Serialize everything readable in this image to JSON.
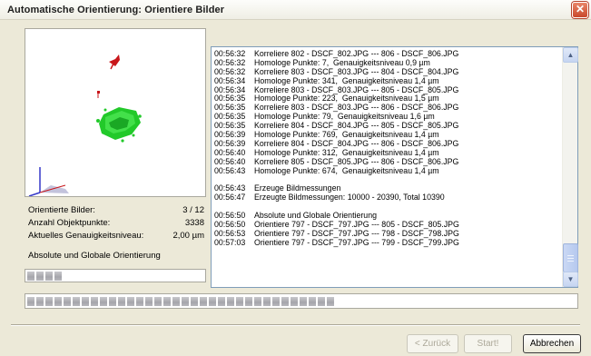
{
  "window": {
    "title": "Automatische Orientierung: Orientiere Bilder",
    "close_label": "✕"
  },
  "stats": [
    {
      "label": "Orientierte Bilder:",
      "value": "3 / 12"
    },
    {
      "label": "Anzahl Objektpunkte:",
      "value": "3338"
    },
    {
      "label": "Aktuelles Genauigkeitsniveau:",
      "value": "2,00 µm"
    }
  ],
  "stage": "Absolute und Globale Orientierung",
  "small_progress_segments": 4,
  "big_progress_segments": 34,
  "log": [
    {
      "time": "00:56:32",
      "text": "Korreliere 802 - DSCF_802.JPG --- 806 - DSCF_806.JPG"
    },
    {
      "time": "00:56:32",
      "text": "Homologe Punkte: 7,  Genauigkeitsniveau 0,9 µm"
    },
    {
      "time": "00:56:32",
      "text": "Korreliere 803 - DSCF_803.JPG --- 804 - DSCF_804.JPG"
    },
    {
      "time": "00:56:34",
      "text": "Homologe Punkte: 341,  Genauigkeitsniveau 1,4 µm"
    },
    {
      "time": "00:56:34",
      "text": "Korreliere 803 - DSCF_803.JPG --- 805 - DSCF_805.JPG"
    },
    {
      "time": "00:56:35",
      "text": "Homologe Punkte: 223,  Genauigkeitsniveau 1,5 µm"
    },
    {
      "time": "00:56:35",
      "text": "Korreliere 803 - DSCF_803.JPG --- 806 - DSCF_806.JPG"
    },
    {
      "time": "00:56:35",
      "text": "Homologe Punkte: 79,  Genauigkeitsniveau 1,6 µm"
    },
    {
      "time": "00:56:35",
      "text": "Korreliere 804 - DSCF_804.JPG --- 805 - DSCF_805.JPG"
    },
    {
      "time": "00:56:39",
      "text": "Homologe Punkte: 769,  Genauigkeitsniveau 1,4 µm"
    },
    {
      "time": "00:56:39",
      "text": "Korreliere 804 - DSCF_804.JPG --- 806 - DSCF_806.JPG"
    },
    {
      "time": "00:56:40",
      "text": "Homologe Punkte: 312,  Genauigkeitsniveau 1,4 µm"
    },
    {
      "time": "00:56:40",
      "text": "Korreliere 805 - DSCF_805.JPG --- 806 - DSCF_806.JPG"
    },
    {
      "time": "00:56:43",
      "text": "Homologe Punkte: 674,  Genauigkeitsniveau 1,4 µm"
    },
    {
      "time": "",
      "text": ""
    },
    {
      "time": "00:56:43",
      "text": "Erzeuge Bildmessungen"
    },
    {
      "time": "00:56:47",
      "text": "Erzeugte Bildmessungen: 10000 - 20390, Total 10390"
    },
    {
      "time": "",
      "text": ""
    },
    {
      "time": "00:56:50",
      "text": "Absolute und Globale Orientierung"
    },
    {
      "time": "00:56:50",
      "text": "Orientiere 797 - DSCF_797.JPG --- 805 - DSCF_805.JPG"
    },
    {
      "time": "00:56:53",
      "text": "Orientiere 797 - DSCF_797.JPG --- 798 - DSCF_798.JPG"
    },
    {
      "time": "00:57:03",
      "text": "Orientiere 797 - DSCF_797.JPG --- 799 - DSCF_799.JPG"
    }
  ],
  "buttons": {
    "back": "< Zurück",
    "start": "Start!",
    "cancel": "Abbrechen"
  },
  "colors": {
    "point_cloud": "#22c92a",
    "camera_marker": "#c8161a",
    "axis_blue": "#3437c8"
  }
}
